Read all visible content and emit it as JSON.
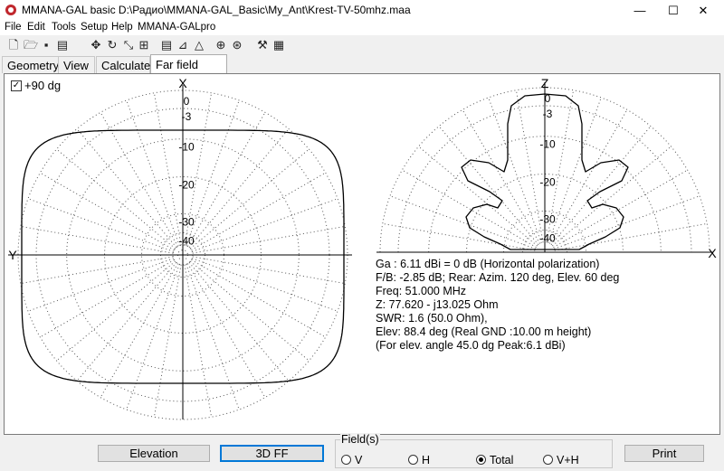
{
  "window": {
    "title": "MMANA-GAL basic  D:\\Радио\\MMANA-GAL_Basic\\My_Ant\\Krest-TV-50mhz.maa",
    "minimize": "—",
    "maximize": "☐",
    "close": "✕"
  },
  "menu": [
    "File",
    "Edit",
    "Tools",
    "Setup",
    "Help",
    "MMANA-GALpro"
  ],
  "toolbar": [
    "new-icon",
    "open-icon",
    "save-icon",
    "save-as-icon",
    "move-icon",
    "rotate-icon",
    "resize-icon",
    "wire-icon",
    "table-icon",
    "chart-icon",
    "triangle-icon",
    "target-icon",
    "globe-icon",
    "tools-icon",
    "calculator-icon"
  ],
  "tabs": [
    "Geometry",
    "View",
    "Calculate",
    "Far field plots"
  ],
  "active_tab": "Far field plots",
  "plot": {
    "checkbox_label": "+90 dg",
    "checked": true,
    "left_axis": {
      "top": "X",
      "side": "Y"
    },
    "right_axis": {
      "top": "Z",
      "side": "X"
    },
    "db_labels": [
      "0",
      "-3",
      "-10",
      "-20",
      "-30",
      "-40"
    ]
  },
  "info": {
    "line1": "Ga : 6.11 dBi = 0 dB  (Horizontal polarization)",
    "line2": "F/B: -2.85 dB; Rear: Azim. 120 deg,  Elev. 60 deg",
    "line3": "Freq: 51.000 MHz",
    "line4": "Z: 77.620 - j13.025 Ohm",
    "line5": "SWR: 1.6 (50.0 Ohm),",
    "line6": "Elev: 88.4 deg (Real GND  :10.00 m height)",
    "line7": "(For elev. angle 45.0 dg Peak:6.1 dBi)"
  },
  "bottom": {
    "elevation": "Elevation",
    "ff3d": "3D FF",
    "field_legend": "Field(s)",
    "radios": [
      {
        "label": "V",
        "selected": false
      },
      {
        "label": "H",
        "selected": false
      },
      {
        "label": "Total",
        "selected": true
      },
      {
        "label": "V+H",
        "selected": false
      }
    ],
    "print": "Print"
  }
}
